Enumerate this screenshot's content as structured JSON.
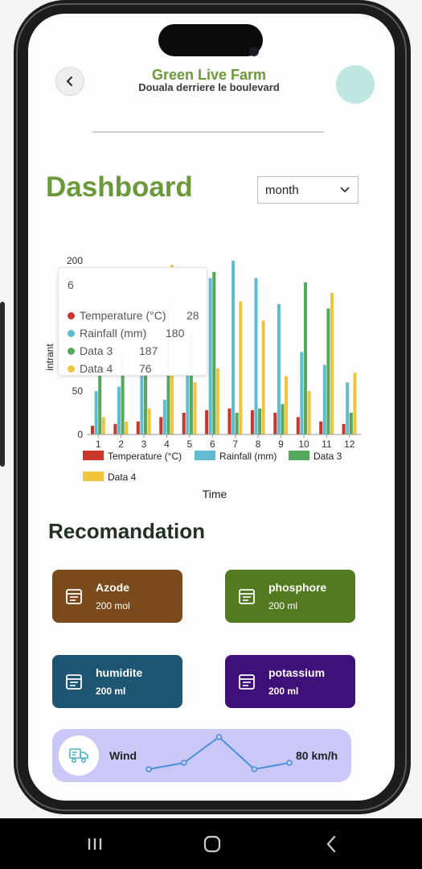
{
  "header": {
    "farm_name": "Green Live Farm",
    "location": "Douala derriere le boulevard"
  },
  "dashboard": {
    "title": "Dashboard",
    "period_selected": "month"
  },
  "chart_data": {
    "type": "bar",
    "categories": [
      "1",
      "2",
      "3",
      "4",
      "5",
      "6",
      "7",
      "8",
      "9",
      "10",
      "11",
      "12"
    ],
    "series": [
      {
        "name": "Temperature (°C)",
        "color": "#c9362b",
        "values": [
          10,
          12,
          15,
          20,
          25,
          28,
          30,
          28,
          25,
          20,
          15,
          12
        ]
      },
      {
        "name": "Rainfall (mm)",
        "color": "#62bccf",
        "values": [
          50,
          55,
          80,
          40,
          70,
          180,
          200,
          180,
          150,
          95,
          80,
          60
        ]
      },
      {
        "name": "Data 3",
        "color": "#56a85c",
        "values": [
          70,
          95,
          120,
          150,
          120,
          187,
          25,
          30,
          35,
          175,
          145,
          25
        ]
      },
      {
        "name": "Data 4",
        "color": "#f0c43c",
        "values": [
          20,
          15,
          30,
          195,
          60,
          76,
          153,
          131,
          67,
          50,
          163,
          71
        ]
      }
    ],
    "ylim": [
      0,
      200
    ],
    "yticks": [
      0,
      50,
      200
    ],
    "xlabel": "Time",
    "ylabel": "intrant",
    "legend": "bottom",
    "grid": false,
    "tooltip": {
      "title": "6",
      "rows": [
        {
          "name": "Temperature (°C)",
          "value": "28",
          "color": "#c9362b"
        },
        {
          "name": "Rainfall (mm)",
          "value": "180",
          "color": "#62bccf"
        },
        {
          "name": "Data 3",
          "value": "187",
          "color": "#56a85c"
        },
        {
          "name": "Data 4",
          "value": "76",
          "color": "#f0c43c"
        }
      ]
    }
  },
  "recommendation": {
    "title": "Recomandation",
    "cards": [
      {
        "name": "Azode",
        "value": "200 mol",
        "color": "#7a4a1c",
        "icon": "calendar-icon"
      },
      {
        "name": "phosphore",
        "value": "200 ml",
        "color": "#537a1f",
        "icon": "calendar-icon"
      },
      {
        "name": "humidite",
        "value": "200 ml",
        "color": "#1e5572",
        "icon": "calendar-icon"
      },
      {
        "name": "potassium",
        "value": "200 ml",
        "color": "#3f0f7a",
        "icon": "calendar-icon"
      }
    ]
  },
  "wind": {
    "label": "Wind",
    "value": "80 km/h",
    "icon": "wind-truck-icon",
    "trend": [
      2,
      4,
      12,
      2,
      4
    ]
  },
  "android_nav": {
    "recents_icon": "recents-icon",
    "home_icon": "home-icon",
    "back_icon": "back-icon"
  }
}
